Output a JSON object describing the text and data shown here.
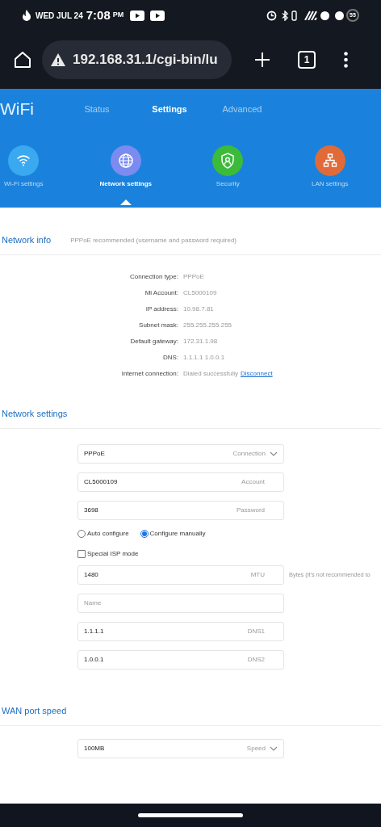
{
  "status_bar": {
    "date": "WED JUL 24",
    "time": "7:08",
    "ampm": "PM",
    "battery": "55"
  },
  "browser": {
    "url": "192.168.31.1/cgi-bin/lu",
    "tab_count": "1"
  },
  "header": {
    "logo": "WiFi",
    "tabs": [
      {
        "label": "Status",
        "selected": false
      },
      {
        "label": "Settings",
        "selected": true
      },
      {
        "label": "Advanced",
        "selected": false
      }
    ],
    "sections": [
      {
        "kind": "wifi",
        "label": "Wi-Fi settings",
        "selected": false,
        "color": "#3aa9f0"
      },
      {
        "kind": "globe",
        "label": "Network settings",
        "selected": true,
        "color": "#7b8bef"
      },
      {
        "kind": "shield",
        "label": "Security",
        "selected": false,
        "color": "#3cba3a"
      },
      {
        "kind": "lan",
        "label": "LAN settings",
        "selected": false,
        "color": "#e06a38"
      }
    ]
  },
  "network_info": {
    "title": "Network info",
    "note": "PPPoE recommended (username and password required)",
    "rows": [
      {
        "label": "Connection type:",
        "value": "PPPoE"
      },
      {
        "label": "Mi Account:",
        "value": "CL5000109"
      },
      {
        "label": "IP address:",
        "value": "10.98.7.81"
      },
      {
        "label": "Subnet mask:",
        "value": "255.255.255.255"
      },
      {
        "label": "Default gateway:",
        "value": "172.31.1.98"
      },
      {
        "label": "DNS:",
        "value": "1.1.1.1 1.0.0.1"
      },
      {
        "label": "Internet connection:",
        "value": "Dialed successfully",
        "link": "Disconnect"
      }
    ]
  },
  "network_settings": {
    "title": "Network settings",
    "fields_top": [
      {
        "kind": "select",
        "value": "PPPoE",
        "hint": "Connection"
      },
      {
        "kind": "input",
        "value": "CL5000109",
        "hint": "Account"
      },
      {
        "kind": "input",
        "value": "3698",
        "hint": "Password"
      }
    ],
    "radios": [
      {
        "label": "Auto configure",
        "selected": false
      },
      {
        "label": "Configure manually",
        "selected": true
      }
    ],
    "special_isp": {
      "label": "Special ISP mode",
      "checked": false
    },
    "fields_bottom": [
      {
        "value": "1480",
        "hint": "MTU",
        "note": "Bytes (It's not recommended to"
      },
      {
        "placeholder": "Name"
      },
      {
        "value": "1.1.1.1",
        "hint": "DNS1"
      },
      {
        "value": "1.0.0.1",
        "hint": "DNS2"
      }
    ]
  },
  "wan_port_speed": {
    "title": "WAN port speed",
    "field": {
      "kind": "select",
      "value": "100MB",
      "hint": "Speed"
    }
  }
}
